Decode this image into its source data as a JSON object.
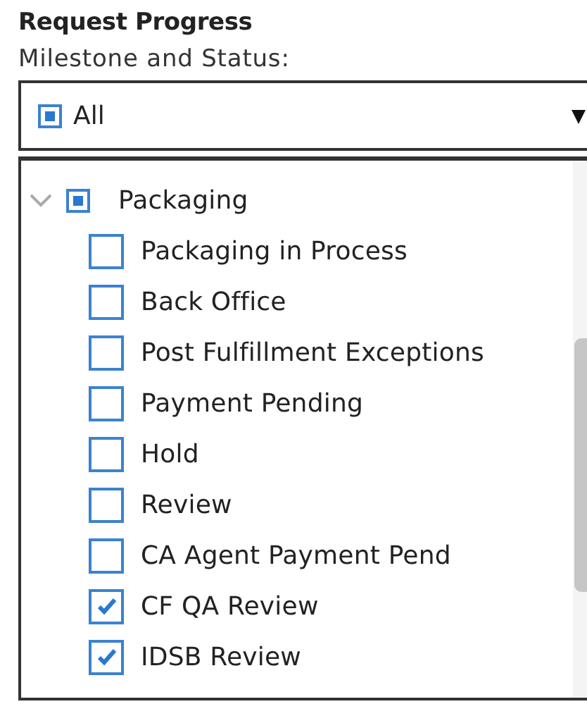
{
  "title": "Request Progress",
  "label": "Milestone and Status:",
  "dropdown": {
    "value": "All",
    "partial": true,
    "expanded": true
  },
  "tree": [
    {
      "label": "Packaging",
      "expanded": true,
      "partial": true,
      "children": [
        {
          "label": "Packaging in Process",
          "checked": false
        },
        {
          "label": "Back Office",
          "checked": false
        },
        {
          "label": "Post Fulfillment Exceptions",
          "checked": false
        },
        {
          "label": "Payment Pending",
          "checked": false
        },
        {
          "label": "Hold",
          "checked": false
        },
        {
          "label": "Review",
          "checked": false
        },
        {
          "label": "CA Agent Payment Pend",
          "checked": false
        },
        {
          "label": "CF QA Review",
          "checked": true
        },
        {
          "label": "IDSB Review",
          "checked": true
        }
      ]
    }
  ]
}
